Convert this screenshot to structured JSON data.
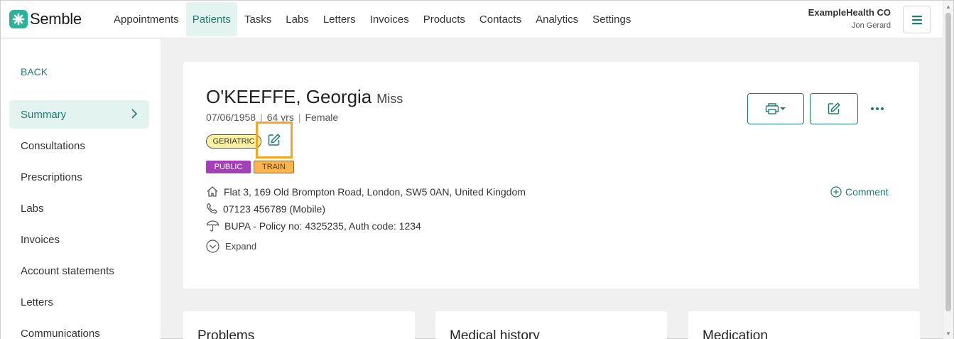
{
  "app": {
    "brand": "Semble",
    "brand_color": "#2bb39a",
    "accent_color": "#1f7d70"
  },
  "nav": {
    "items": [
      {
        "label": "Appointments",
        "active": false
      },
      {
        "label": "Patients",
        "active": true
      },
      {
        "label": "Tasks",
        "active": false
      },
      {
        "label": "Labs",
        "active": false
      },
      {
        "label": "Letters",
        "active": false
      },
      {
        "label": "Invoices",
        "active": false
      },
      {
        "label": "Products",
        "active": false
      },
      {
        "label": "Contacts",
        "active": false
      },
      {
        "label": "Analytics",
        "active": false
      },
      {
        "label": "Settings",
        "active": false
      }
    ],
    "org_name": "ExampleHealth CO",
    "user_name": "Jon Gerard"
  },
  "sidebar": {
    "back_label": "BACK",
    "items": [
      {
        "label": "Summary",
        "active": true
      },
      {
        "label": "Consultations"
      },
      {
        "label": "Prescriptions"
      },
      {
        "label": "Labs"
      },
      {
        "label": "Invoices"
      },
      {
        "label": "Account statements"
      },
      {
        "label": "Letters"
      },
      {
        "label": "Communications"
      }
    ]
  },
  "patient": {
    "name": "O'KEEFFE, Georgia",
    "title": "Miss",
    "dob": "07/06/1958",
    "age": "64 yrs",
    "sex": "Female",
    "tag": "GERIATRIC",
    "badges": [
      "PUBLIC",
      "TRAIN"
    ],
    "address": "Flat 3, 169 Old Brompton Road, London, SW5 0AN, United Kingdom",
    "phone": "07123 456789 (Mobile)",
    "insurance": "BUPA - Policy no: 4325235, Auth code: 1234",
    "expand_label": "Expand",
    "comment_label": "Comment",
    "icons": {
      "edit_tags": "pencil-square-icon",
      "address": "home-icon",
      "phone": "phone-icon",
      "insurance": "umbrella-icon",
      "expand": "chevron-circle-down-icon",
      "comment": "plus-circle-icon",
      "print": "printer-icon",
      "edit": "pencil-square-icon",
      "more": "ellipsis-icon"
    }
  },
  "panels": [
    {
      "title": "Problems"
    },
    {
      "title": "Medical history"
    },
    {
      "title": "Medication"
    }
  ]
}
